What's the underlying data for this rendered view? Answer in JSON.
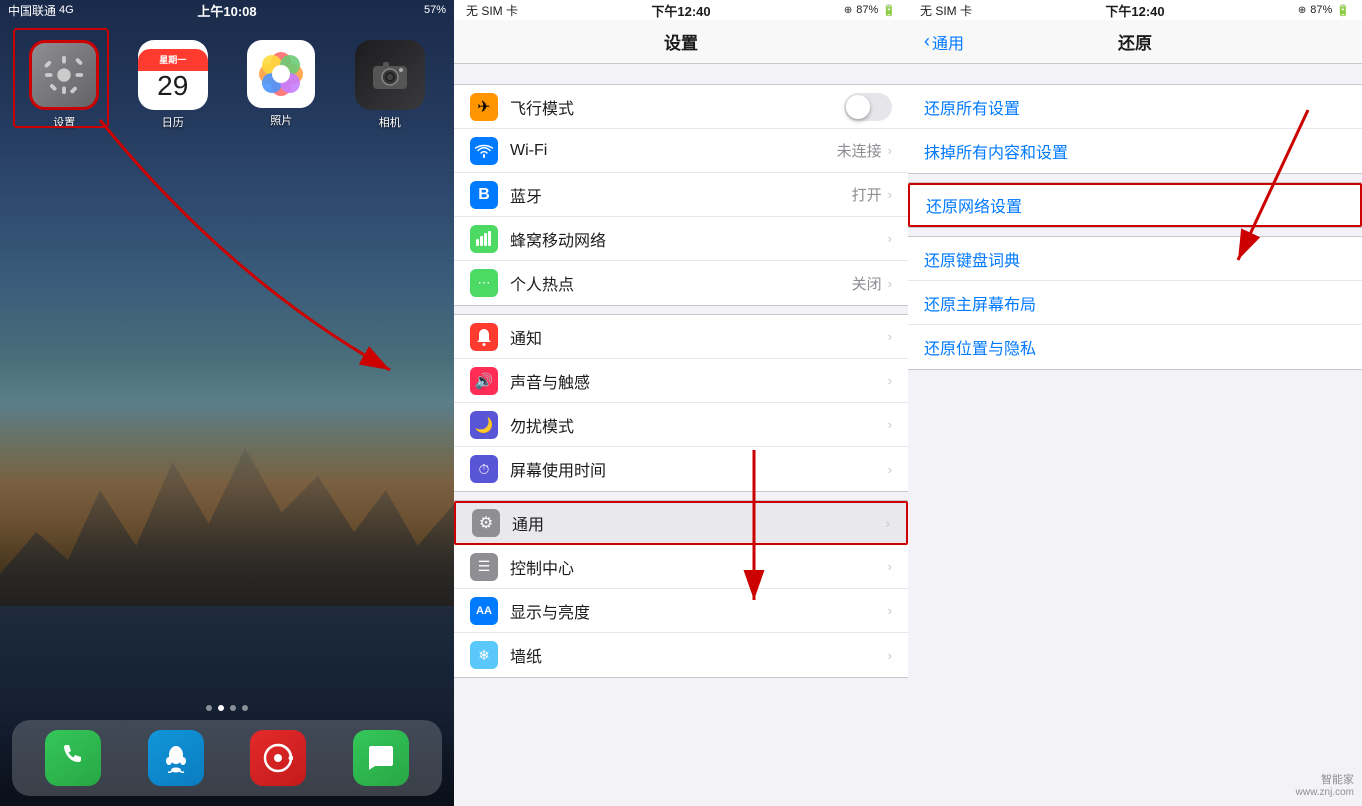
{
  "left": {
    "status": {
      "carrier": "中国联通",
      "network": "4G",
      "time": "上午10:08",
      "battery": "57%"
    },
    "apps": [
      {
        "id": "settings",
        "label": "设置",
        "type": "settings"
      },
      {
        "id": "calendar",
        "label": "日历",
        "type": "calendar",
        "day": "29",
        "weekday": "星期一"
      },
      {
        "id": "photos",
        "label": "照片",
        "type": "photos"
      },
      {
        "id": "camera",
        "label": "相机",
        "type": "camera"
      }
    ],
    "dock": [
      {
        "id": "phone",
        "label": "电话",
        "type": "phone"
      },
      {
        "id": "qq",
        "label": "QQ",
        "type": "qq"
      },
      {
        "id": "netease",
        "label": "网易云",
        "type": "netease"
      },
      {
        "id": "messages",
        "label": "信息",
        "type": "messages"
      }
    ]
  },
  "middle": {
    "status": {
      "carrier": "无 SIM 卡",
      "time": "下午12:40",
      "battery": "87%"
    },
    "title": "设置",
    "sections": [
      {
        "items": [
          {
            "id": "airplane",
            "icon": "✈",
            "iconBg": "airplane",
            "label": "飞行模式",
            "type": "toggle"
          },
          {
            "id": "wifi",
            "icon": "📶",
            "iconBg": "wifi",
            "label": "Wi-Fi",
            "value": "未连接",
            "type": "nav"
          },
          {
            "id": "bluetooth",
            "icon": "🔷",
            "iconBg": "bluetooth",
            "label": "蓝牙",
            "value": "打开",
            "type": "nav"
          },
          {
            "id": "cellular",
            "icon": "📡",
            "iconBg": "cellular",
            "label": "蜂窝移动网络",
            "type": "nav"
          },
          {
            "id": "hotspot",
            "icon": "📲",
            "iconBg": "hotspot",
            "label": "个人热点",
            "value": "关闭",
            "type": "nav"
          }
        ]
      },
      {
        "items": [
          {
            "id": "notification",
            "icon": "🔔",
            "iconBg": "notification",
            "label": "通知",
            "type": "nav"
          },
          {
            "id": "sound",
            "icon": "🔊",
            "iconBg": "sound",
            "label": "声音与触感",
            "type": "nav"
          },
          {
            "id": "dnd",
            "icon": "🌙",
            "iconBg": "dnd",
            "label": "勿扰模式",
            "type": "nav"
          },
          {
            "id": "screentime",
            "icon": "⏱",
            "iconBg": "screentime",
            "label": "屏幕使用时间",
            "type": "nav"
          }
        ]
      },
      {
        "items": [
          {
            "id": "general",
            "icon": "⚙",
            "iconBg": "general",
            "label": "通用",
            "type": "nav",
            "highlighted": true
          },
          {
            "id": "control",
            "icon": "🎛",
            "iconBg": "control",
            "label": "控制中心",
            "type": "nav"
          },
          {
            "id": "display",
            "icon": "AA",
            "iconBg": "display",
            "label": "显示与亮度",
            "type": "nav"
          },
          {
            "id": "wallpaper",
            "icon": "❄",
            "iconBg": "wallpaper",
            "label": "墙纸",
            "type": "nav"
          }
        ]
      }
    ]
  },
  "right": {
    "status": {
      "carrier": "无 SIM 卡",
      "time": "下午12:40",
      "battery": "87%"
    },
    "backLabel": "通用",
    "title": "还原",
    "items": [
      {
        "id": "reset-all",
        "label": "还原所有设置"
      },
      {
        "id": "erase-all",
        "label": "抹掉所有内容和设置"
      },
      {
        "id": "reset-network",
        "label": "还原网络设置",
        "highlighted": true
      },
      {
        "id": "reset-keyboard",
        "label": "还原键盘词典"
      },
      {
        "id": "reset-homescreen",
        "label": "还原主屏幕布局"
      },
      {
        "id": "reset-location",
        "label": "还原位置与隐私"
      }
    ]
  },
  "watermark": {
    "line1": "智能家",
    "line2": "www.znj.com"
  }
}
